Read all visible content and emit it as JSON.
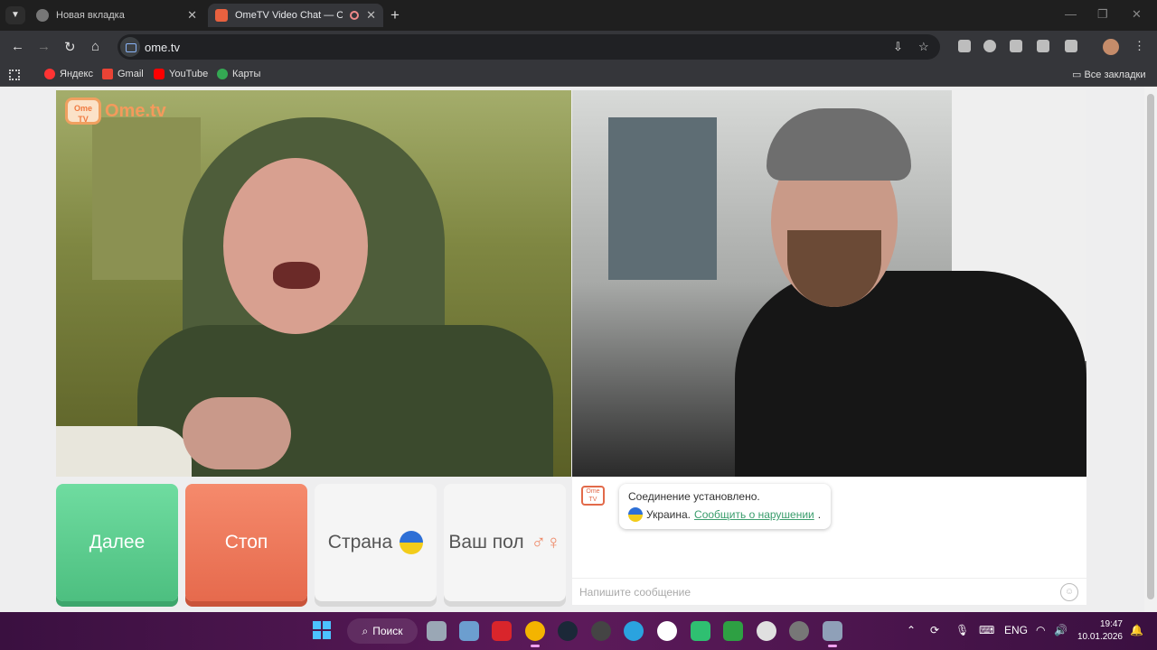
{
  "browser": {
    "tabs": [
      {
        "title": "Новая вкладка"
      },
      {
        "title": "OmeTV Video Chat — Ome"
      }
    ],
    "url": "ome.tv",
    "bookmarks": [
      {
        "label": "Яндекс",
        "color": "#ff3333"
      },
      {
        "label": "Gmail",
        "color": "#ea4335"
      },
      {
        "label": "YouTube",
        "color": "#ff0000"
      },
      {
        "label": "Карты",
        "color": "#34a853"
      }
    ],
    "all_bookmarks": "Все закладки"
  },
  "page": {
    "logo_text": "Ome.tv",
    "logo_badge": "Ome TV",
    "buttons": {
      "next": "Далее",
      "stop": "Стоп",
      "country": "Страна",
      "gender": "Ваш пол"
    },
    "chat": {
      "status": "Соединение установлено.",
      "country": "Украина.",
      "report_link": "Сообщить о нарушении",
      "report_suffix": ".",
      "input_placeholder": "Напишите сообщение"
    }
  },
  "taskbar": {
    "search": "Поиск",
    "language": "ENG",
    "time": "19:47",
    "date": "10.01.2026"
  },
  "colors": {
    "next": "#5fcf8f",
    "stop": "#ec7658",
    "link": "#3a9d6c",
    "taskbar": "#4a1550"
  }
}
